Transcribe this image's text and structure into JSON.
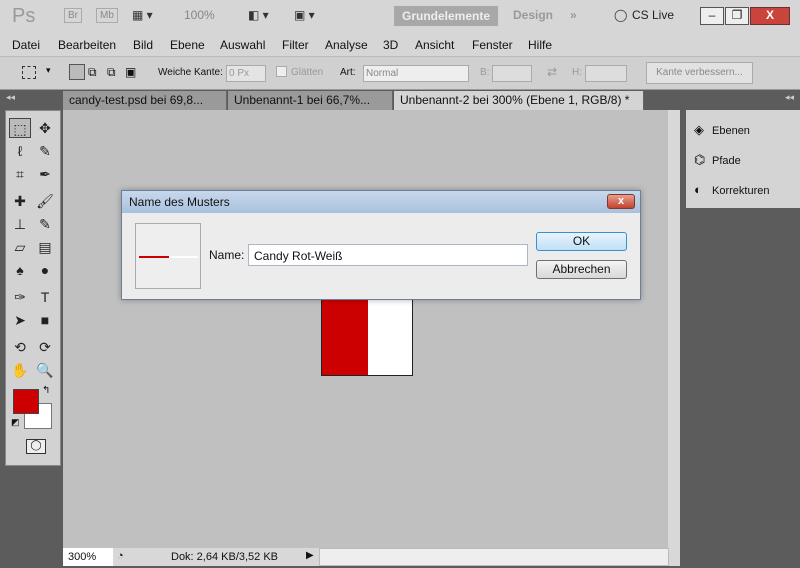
{
  "titlebar": {
    "app_logo": "Ps",
    "bridge": "Br",
    "minibridge": "Mb",
    "zoom": "100%",
    "workspace_active": "Grundelemente",
    "workspace_other": "Design",
    "more": "»",
    "cslive": "CS Live"
  },
  "menu": [
    "Datei",
    "Bearbeiten",
    "Bild",
    "Ebene",
    "Auswahl",
    "Filter",
    "Analyse",
    "3D",
    "Ansicht",
    "Fenster",
    "Hilfe"
  ],
  "options": {
    "feather_label": "Weiche Kante:",
    "feather_value": "0 Px",
    "antialias_label": "Glätten",
    "style_label": "Art:",
    "style_value": "Normal",
    "width_label": "B:",
    "height_label": "H:",
    "refine_button": "Kante verbessern..."
  },
  "tabs": [
    {
      "label": "candy-test.psd bei 69,8...",
      "active": false
    },
    {
      "label": "Unbenannt-1 bei 66,7%...",
      "active": false
    },
    {
      "label": "Unbenannt-2 bei 300% (Ebene 1, RGB/8) *",
      "active": true
    }
  ],
  "panels": [
    {
      "label": "Ebenen",
      "icon": "layers-icon"
    },
    {
      "label": "Pfade",
      "icon": "paths-icon"
    },
    {
      "label": "Korrekturen",
      "icon": "adjustments-icon"
    }
  ],
  "colors": {
    "foreground": "#cc0000",
    "background": "#ffffff"
  },
  "status": {
    "zoom": "300%",
    "doc": "Dok: 2,64 KB/3,52 KB"
  },
  "dialog": {
    "title": "Name des Musters",
    "name_label": "Name:",
    "name_value": "Candy Rot-Weiß",
    "ok": "OK",
    "cancel": "Abbrechen"
  }
}
